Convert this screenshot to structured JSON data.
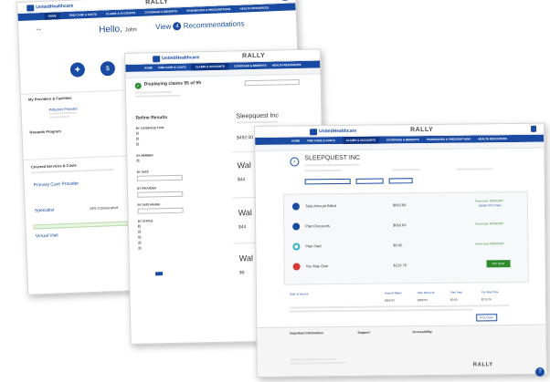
{
  "brand": {
    "name": "UnitedHealthcare",
    "rally_prefix": "RALLY",
    "rally_suffix": "",
    "accent": "#1a4ba3",
    "rally_accent": "#e57a1f"
  },
  "dashboard": {
    "nav": [
      "HOME",
      "FIND CARE & COSTS",
      "CLAIMS & ACCOUNTS",
      "COVERAGE & BENEFITS",
      "PHARMACIES & PRESCRIPTIONS",
      "HEALTH RESOURCES"
    ],
    "profile_button": "",
    "greeting": "Hello,",
    "user": "John",
    "view_label": "View",
    "recommendation_count": "4",
    "recommendations_label": "Recommendations",
    "tiles": [
      "",
      ""
    ],
    "providers_heading": "My Providers & Facilities",
    "provider_name": "Pollution Provider",
    "rewards_heading": "Rewards Program",
    "services_heading": "Covered Services & Costs",
    "service_items": [
      "Primary Care Provider",
      "Specialist",
      "Virtual Visit"
    ],
    "service_pcts": [
      "",
      "10% Coinsurance",
      ""
    ]
  },
  "claims": {
    "status": "Displaying claims",
    "count_text": "95 of 95",
    "refine_heading": "Refine Results",
    "filter_sections": [
      "BY COVERAGE TYPE",
      "BY MEMBER",
      "BY DATE",
      "BY PROVIDER",
      "BY DATE RANGE",
      "BY STATUS"
    ],
    "claim_provider": "Sleepquest Inc",
    "claim_amount": "$492.00",
    "other_claims": [
      "Wal",
      "Wal",
      "Wal"
    ],
    "other_amounts": [
      "$44",
      "$44",
      "$6"
    ],
    "submit_button": ""
  },
  "detail": {
    "provider": "SLEEPQUEST INC",
    "rows": [
      {
        "label": "Total Amount Billed",
        "value": "$660.84",
        "status": "Processed: 00/00/2020",
        "status2": "Explain This Claim",
        "color": "#1a4ba3"
      },
      {
        "label": "Plan Discounts",
        "value": "$660.84",
        "status": "Processed: 00/00/2020",
        "status2": "",
        "color": "#1a4ba3"
      },
      {
        "label": "Plan Paid",
        "value": "$0.00",
        "status": "Processed: 00/00/2020",
        "status2": "",
        "color": "#2bb3c8"
      },
      {
        "label": "You May Owe",
        "value": "$210.76",
        "status": "",
        "status2": "",
        "color": "#d83a3a"
      }
    ],
    "pay_button": "PAY NOW",
    "summary_cols": [
      "Date of Service",
      "Amount Billed",
      "Plan Discount",
      "Plan Paid",
      "You May Owe"
    ],
    "summary_values": [
      "$660.84",
      "$660.84",
      "$0.00",
      "$210.76"
    ],
    "print_button": "Print Claim",
    "footer_cols": [
      {
        "heading": "Important Information",
        "items": [
          "",
          "",
          "",
          ""
        ]
      },
      {
        "heading": "Support",
        "items": [
          "",
          ""
        ]
      },
      {
        "heading": "Accessibility",
        "items": [
          "",
          "",
          ""
        ]
      }
    ],
    "footer_brand_prefix": "RALLY",
    "footer_brand_suffix": ""
  }
}
